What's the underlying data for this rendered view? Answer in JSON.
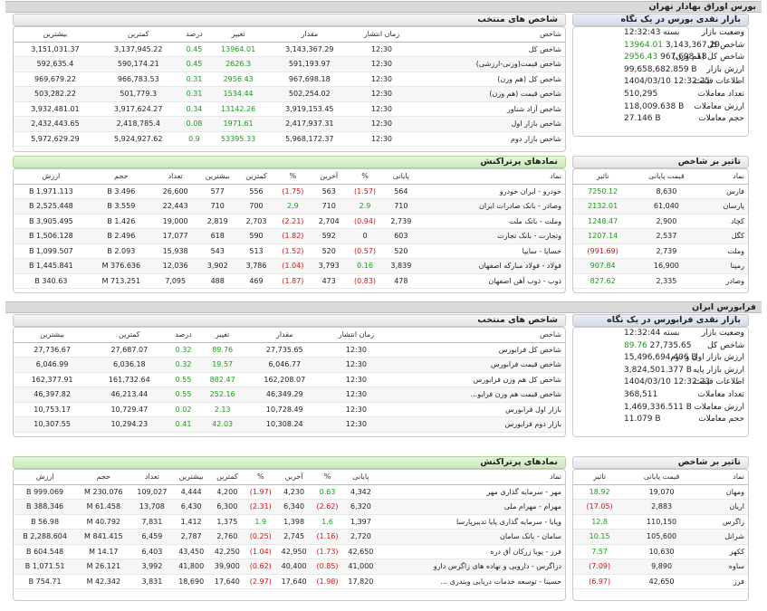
{
  "bourse": {
    "header": "بورس اوراق بهادار تهران",
    "summary_title": "بازار نقدی بورس در یک نگاه",
    "summary": [
      {
        "label": "وضعیت بازار",
        "value": "بسته 12:32:43"
      },
      {
        "label": "شاخص کل",
        "value": "3,143,367.29",
        "change": "13964.01",
        "dir": "g"
      },
      {
        "label": "شاخص کل (هم وزن)",
        "value": "967,698.18",
        "change": "2956.43",
        "dir": "g"
      },
      {
        "label": "ارزش بازار",
        "value": "99,658,682.859 B"
      },
      {
        "label": "اطلاعات قیمت",
        "value": "1404/03/10 12:32:25"
      },
      {
        "label": "تعداد معاملات",
        "value": "510,295"
      },
      {
        "label": "ارزش معاملات",
        "value": "118,009.638 B"
      },
      {
        "label": "حجم معاملات",
        "value": "27.146 B"
      }
    ],
    "indices_title": "شاخص های منتخب",
    "indices_headers": [
      "شاخص",
      "زمان انتشار",
      "مقدار",
      "تغییر",
      "درصد",
      "کمترین",
      "بیشترین"
    ],
    "indices": [
      [
        "شاخص کل",
        "12:30",
        "3,143,367.29",
        "13964.01",
        "0.45",
        "3,137,945.22",
        "3,151,031.37",
        "g"
      ],
      [
        "شاخص قیمت(وزنی-ارزشی)",
        "12:30",
        "591,193.97",
        "2626.3",
        "0.45",
        "590,174.21",
        "592,635.4",
        "g"
      ],
      [
        "شاخص کل (هم وزن)",
        "12:30",
        "967,698.18",
        "2956.43",
        "0.31",
        "966,783.53",
        "969,679.22",
        "g"
      ],
      [
        "شاخص قیمت (هم وزن)",
        "12:30",
        "502,254.02",
        "1534.44",
        "0.31",
        "501,779.3",
        "503,282.22",
        "g"
      ],
      [
        "شاخص آزاد شناور",
        "12:30",
        "3,919,153.45",
        "13142.26",
        "0.34",
        "3,917,624.27",
        "3,932,481.01",
        "g"
      ],
      [
        "شاخص بازار اول",
        "12:30",
        "2,417,937.31",
        "1971.61",
        "0.08",
        "2,418,785.4",
        "2,432,443.65",
        "g"
      ],
      [
        "شاخص بازار دوم",
        "12:30",
        "5,968,172.37",
        "53395.33",
        "0.9",
        "5,924,927.62",
        "5,972,629.29",
        "g"
      ]
    ],
    "impact_title": "تاثیر بر شاخص",
    "impact_headers": [
      "نماد",
      "قیمت پایانی",
      "تاثیر"
    ],
    "impact": [
      [
        "فارس",
        "8,630",
        "7250.12",
        "g"
      ],
      [
        "پارسان",
        "61,040",
        "2132.01",
        "g"
      ],
      [
        "کچاد",
        "2,900",
        "1248.47",
        "g"
      ],
      [
        "کگل",
        "2,537",
        "1207.14",
        "g"
      ],
      [
        "وملت",
        "2,739",
        "(991.69)",
        "r"
      ],
      [
        "رمپنا",
        "16,900",
        "907.84",
        "g"
      ],
      [
        "وصادر",
        "2,335",
        "827.62",
        "g"
      ]
    ],
    "symbols_title": "نمادهای پرتراکنش",
    "symbols_headers": [
      "نماد",
      "پایانی",
      "%",
      "آخرین",
      "%",
      "کمترین",
      "بیشترین",
      "تعداد",
      "حجم",
      "ارزش"
    ],
    "symbols": [
      [
        "خودرو - ایران خودرو",
        "564",
        "(1.57)",
        "563",
        "(1.75)",
        "556",
        "577",
        "26,600",
        "3.496 B",
        "1,971.113 B",
        "r",
        "r"
      ],
      [
        "وصادر - بانک صادرات ایران",
        "710",
        "2.9",
        "710",
        "2.9",
        "700",
        "710",
        "22,443",
        "3.559 B",
        "2,525.448 B",
        "g",
        "g"
      ],
      [
        "وملت - بانک ملت",
        "2,739",
        "(0.94)",
        "2,704",
        "(2.21)",
        "2,703",
        "2,819",
        "19,000",
        "1.426 B",
        "3,905.495 B",
        "r",
        "r"
      ],
      [
        "وتجارت - بانک تجارت",
        "603",
        "0",
        "592",
        "(1.82)",
        "590",
        "618",
        "17,077",
        "2.496 B",
        "1,506.128 B",
        "n",
        "r"
      ],
      [
        "خساپا - سایپا",
        "520",
        "(0.57)",
        "520",
        "(1.52)",
        "513",
        "543",
        "15,938",
        "2.093 B",
        "1,099.507 B",
        "r",
        "r"
      ],
      [
        "فولاد - فولاد مبارکه اصفهان",
        "3,839",
        "0.16",
        "3,793",
        "(1.04)",
        "3,786",
        "3,902",
        "12,036",
        "376.636 M",
        "1,445.841 B",
        "g",
        "r"
      ],
      [
        "ذوب - ذوب آهن اصفهان",
        "478",
        "(0.83)",
        "473",
        "(1.87)",
        "469",
        "488",
        "7,095",
        "713.251 M",
        "340.63 B",
        "r",
        "r"
      ]
    ]
  },
  "farabourse": {
    "header": "فرابورس ایران",
    "summary_title": "بازار نقدی فرابورس در یک نگاه",
    "summary": [
      {
        "label": "وضعیت بازار",
        "value": "بسته 12:32:44"
      },
      {
        "label": "شاخص کل",
        "value": "27,735.65",
        "change": "89.76",
        "dir": "g"
      },
      {
        "label": "ارزش بازار اول و دوم",
        "value": "15,496,694.406 B"
      },
      {
        "label": "ارزش بازار پایه",
        "value": "3,824,501.377 B"
      },
      {
        "label": "اطلاعات قیمت",
        "value": "1404/03/10 12:32:23"
      },
      {
        "label": "تعداد معاملات",
        "value": "368,511"
      },
      {
        "label": "ارزش معاملات",
        "value": "1,469,336.511 B"
      },
      {
        "label": "حجم معاملات",
        "value": "11.079 B"
      }
    ],
    "indices_title": "شاخص های منتخب",
    "indices_headers": [
      "شاخص",
      "زمان انتشار",
      "مقدار",
      "تغییر",
      "درصد",
      "کمترین",
      "بیشترین"
    ],
    "indices": [
      [
        "شاخص کل فرابورس",
        "12:30",
        "27,735.65",
        "89.76",
        "0.32",
        "27,687.07",
        "27,736.67",
        "g"
      ],
      [
        "شاخص قیمت فرابورس",
        "12:30",
        "6,046.77",
        "19.57",
        "0.32",
        "6,036.18",
        "6,046.99",
        "g"
      ],
      [
        "شاخص کل هم وزن فرابورس",
        "12:30",
        "162,208.07",
        "882.47",
        "0.55",
        "161,732.64",
        "162,377.91",
        "g"
      ],
      [
        "شاخص قیمت هم وزن فرابو...",
        "12:30",
        "46,349.29",
        "252.16",
        "0.55",
        "46,213.44",
        "46,397.82",
        "g"
      ],
      [
        "بازار اول فرابورس",
        "12:30",
        "10,728.49",
        "2.13",
        "0.02",
        "10,729.47",
        "10,753.17",
        "g"
      ],
      [
        "بازار دوم فرابورس",
        "12:30",
        "10,308.24",
        "42.03",
        "0.41",
        "10,294.23",
        "10,307.55",
        "g"
      ]
    ],
    "impact_title": "تاثیر بر شاخص",
    "impact_headers": [
      "نماد",
      "قیمت پایانی",
      "تاثیر"
    ],
    "impact": [
      [
        "ومهان",
        "19,070",
        "18.92",
        "g"
      ],
      [
        "اریان",
        "2,883",
        "(17.05)",
        "r"
      ],
      [
        "زاگرس",
        "110,150",
        "12.8",
        "g"
      ],
      [
        "شرانل",
        "105,600",
        "10.15",
        "g"
      ],
      [
        "ککهر",
        "10,630",
        "7.57",
        "g"
      ],
      [
        "ساوه",
        "9,890",
        "(7.09)",
        "r"
      ],
      [
        "فرز",
        "42,650",
        "(6.97)",
        "r"
      ]
    ],
    "symbols_title": "نمادهای پرتراکنش",
    "symbols_headers": [
      "نماد",
      "پایانی",
      "%",
      "آخرین",
      "%",
      "کمترین",
      "بیشترین",
      "تعداد",
      "حجم",
      "ارزش"
    ],
    "symbols": [
      [
        "مهر - سرمایه گذاری مهر",
        "4,342",
        "0.63",
        "4,230",
        "(1.97)",
        "4,200",
        "4,444",
        "109,027",
        "230.076 M",
        "999.069 B",
        "g",
        "r"
      ],
      [
        "مهرام - مهرام ملی",
        "6,320",
        "(2.62)",
        "6,340",
        "(2.31)",
        "6,300",
        "6,430",
        "13,708",
        "61.458 M",
        "388.346 B",
        "r",
        "r"
      ],
      [
        "وپایا - سرمایه گذاری پایا تدبیرپارسا",
        "1,397",
        "1.6",
        "1,398",
        "1.9",
        "1,375",
        "1,412",
        "7,831",
        "40.792 M",
        "56.98 B",
        "g",
        "g"
      ],
      [
        "سامان - بانک سامان",
        "2,720",
        "(1.16)",
        "2,745",
        "(0.25)",
        "2,760",
        "2,787",
        "6,459",
        "841.415 M",
        "2,288.604 B",
        "r",
        "r"
      ],
      [
        "فرز - پویا زرکان آق دره",
        "42,650",
        "(1.73)",
        "42,950",
        "(1.04)",
        "42,250",
        "43,450",
        "6,403",
        "14.17 M",
        "604.548 B",
        "r",
        "r"
      ],
      [
        "دزاگرس - دارویی و نهاده های زاگرس دارو",
        "41,000",
        "(0.85)",
        "40,400",
        "(0.62)",
        "39,900",
        "41,800",
        "3,992",
        "26.121 M",
        "1,071.51 B",
        "r",
        "r"
      ],
      [
        "حسینا - توسعه خدمات دریایی وبندری ...",
        "17,820",
        "(1.98)",
        "17,640",
        "(2.97)",
        "17,640",
        "18,690",
        "3,831",
        "42.342 M",
        "754.71 B",
        "r",
        "r"
      ]
    ]
  }
}
